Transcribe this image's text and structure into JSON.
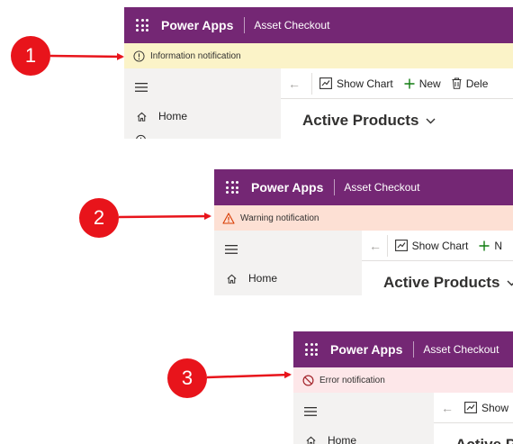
{
  "panels": [
    {
      "app_name": "Power Apps",
      "app_title": "Asset Checkout",
      "notification": {
        "text": "Information notification",
        "icon": "info-circle-icon",
        "color": "#fbf3c8"
      },
      "nav": {
        "home_label": "Home"
      },
      "commands": {
        "show_chart": "Show Chart",
        "new": "New",
        "delete": "Dele"
      },
      "view_title": "Active Products",
      "callout": "1"
    },
    {
      "app_name": "Power Apps",
      "app_title": "Asset Checkout",
      "notification": {
        "text": "Warning notification",
        "icon": "warning-triangle-icon",
        "color": "#fde0d4"
      },
      "nav": {
        "home_label": "Home"
      },
      "commands": {
        "show_chart": "Show Chart",
        "new": "N"
      },
      "view_title": "Active Products",
      "callout": "2"
    },
    {
      "app_name": "Power Apps",
      "app_title": "Asset Checkout",
      "notification": {
        "text": "Error notification",
        "icon": "blocked-circle-icon",
        "color": "#fde7e9"
      },
      "nav": {
        "home_label": "Home"
      },
      "commands": {
        "show_chart": "Show"
      },
      "view_title": "Active Pro",
      "callout": "3"
    }
  ],
  "colors": {
    "header": "#742774",
    "callout": "#e8141b",
    "arrow": "#e8141b"
  }
}
